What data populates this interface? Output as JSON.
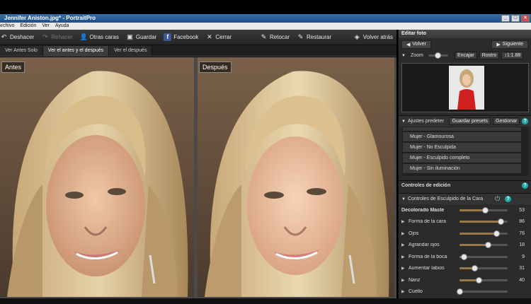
{
  "window": {
    "title": "Jennifer Aniston.jpg* - PortraitPro"
  },
  "window_buttons": [
    "_",
    "□",
    "×"
  ],
  "menu": [
    "Archivo",
    "Edición",
    "Ver",
    "Ayuda"
  ],
  "toolbar": {
    "undo": "Deshacer",
    "redo": "Rehacer",
    "other_faces": "Otras caras",
    "save": "Guardar",
    "facebook": "Facebook",
    "close": "Cerrar",
    "retouch": "Retocar",
    "restore": "Restaurar",
    "back": "Volver atrás"
  },
  "view_tabs": [
    "Ver Antes Solo",
    "Ver el antes y el después",
    "Ver el después"
  ],
  "active_view_tab": 1,
  "labels": {
    "before": "Antes",
    "after": "Después"
  },
  "panel": {
    "edit_photo": "Editar foto",
    "prev": "Volver",
    "next": "Siguiente",
    "zoom": "Zoom",
    "fit": "Encajar",
    "face": "Rostro",
    "ratio": "1:1.88",
    "presets_title": "Ajustes predeter",
    "save_presets": "Guardar presets",
    "manage": "Gestionar",
    "presets": [
      "Mujer - Glamourosa",
      "Mujer - No Esculpida",
      "Mujer - Esculpido completo",
      "Mujer - Sin iluminación"
    ],
    "controls_title": "Controles de edición",
    "sculpt_title": "Controles de Esculpido de la Cara",
    "controls": [
      {
        "label": "Decolorado Maste",
        "value": "53",
        "pct": 0.53,
        "bold": true
      },
      {
        "label": "Forma de la cara",
        "value": "86",
        "pct": 0.86
      },
      {
        "label": "Ojos",
        "value": "76",
        "pct": 0.76
      },
      {
        "label": "Agrandar ojos",
        "value": "18",
        "pct": 0.59
      },
      {
        "label": "Forma de la boca",
        "value": "9",
        "pct": 0.09
      },
      {
        "label": "Aumentar labios",
        "value": "31",
        "pct": 0.31
      },
      {
        "label": "Nariz",
        "value": "40",
        "pct": 0.4
      },
      {
        "label": "Cuello",
        "value": "",
        "pct": 0.0
      }
    ]
  }
}
